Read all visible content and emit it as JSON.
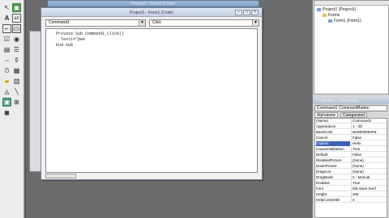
{
  "background_form": {
    "title": "Project1 - Form1 (Code)"
  },
  "code_window": {
    "title": "Project1 - Form1 (Code)",
    "object_combo": "Command1",
    "procedure_combo": "Click",
    "lines": [
      "Private Sub Command1_Click()",
      "  Text1=\"pee",
      "End Sub"
    ]
  },
  "project_explorer": {
    "items": [
      "Project1 (Project1)",
      "Forms",
      "Form1 (Form1)"
    ]
  },
  "properties": {
    "title": "Properties - Command1",
    "object": "Command1  CommandButton",
    "tabs": [
      "Alphabetic",
      "Categorized"
    ],
    "rows": [
      {
        "name": "(Name)",
        "value": "Command1"
      },
      {
        "name": "Appearance",
        "value": "1 - 3D"
      },
      {
        "name": "BackColor",
        "value": "&H8000000F&"
      },
      {
        "name": "Cancel",
        "value": "False"
      },
      {
        "name": "Caption",
        "value": "Hello"
      },
      {
        "name": "CausesValidation",
        "value": "True"
      },
      {
        "name": "Default",
        "value": "False"
      },
      {
        "name": "DisabledPicture",
        "value": "(None)"
      },
      {
        "name": "DownPicture",
        "value": "(None)"
      },
      {
        "name": "DragIcon",
        "value": "(None)"
      },
      {
        "name": "DragMode",
        "value": "0 - Manual"
      },
      {
        "name": "Enabled",
        "value": "True"
      },
      {
        "name": "Font",
        "value": "MS Sans Serif"
      },
      {
        "name": "Height",
        "value": "255"
      },
      {
        "name": "HelpContextID",
        "value": "0"
      }
    ],
    "selected_row": "Caption"
  }
}
